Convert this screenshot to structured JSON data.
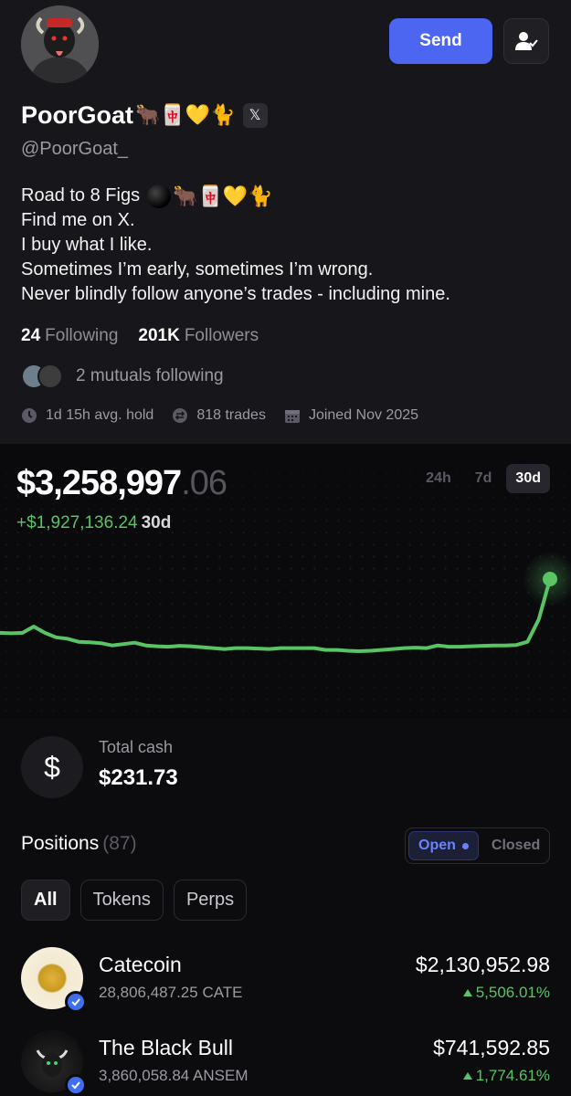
{
  "header": {
    "send_label": "Send"
  },
  "profile": {
    "name": "PoorGoat",
    "name_emojis": "🐂🀄💛🐈",
    "x_badge": "𝕏",
    "handle": "@PoorGoat_",
    "bio": [
      "Road to 8 Figs",
      "Find me on X.",
      "I buy what I like.",
      "Sometimes I’m early, sometimes I’m wrong.",
      "Never blindly follow anyone’s trades - including mine."
    ],
    "bio_emojis": "🐂🀄💛🐈",
    "following_count": "24",
    "following_label": "Following",
    "followers_count": "201K",
    "followers_label": "Followers",
    "mutuals_text": "2 mutuals following",
    "avg_hold": "1d 15h avg. hold",
    "trades": "818 trades",
    "joined": "Joined Nov 2025"
  },
  "portfolio": {
    "balance_main": "$3,258,997",
    "balance_cents": ".06",
    "change_value": "+$1,927,136.24",
    "change_period": "30d",
    "ranges": [
      "24h",
      "7d",
      "30d"
    ],
    "active_range": "30d",
    "accent_color": "#58c463"
  },
  "chart_data": {
    "type": "line",
    "title": "",
    "xlabel": "",
    "ylabel": "",
    "grid": false,
    "legend": "none",
    "x": [
      0,
      1,
      2,
      3,
      4,
      5,
      6,
      7,
      8,
      9,
      10,
      11,
      12,
      13,
      14,
      15,
      16,
      17,
      18,
      19,
      20,
      21,
      22,
      23,
      24,
      25,
      26,
      27,
      28,
      29,
      30,
      31,
      32,
      33,
      34,
      35,
      36,
      37,
      38,
      39,
      40,
      41,
      42,
      43,
      44,
      45,
      46,
      47,
      48,
      49
    ],
    "series": [
      {
        "values": [
          1.0,
          0.99,
          1.0,
          1.14,
          1.0,
          0.9,
          0.87,
          0.8,
          0.79,
          0.77,
          0.72,
          0.75,
          0.78,
          0.72,
          0.7,
          0.69,
          0.71,
          0.7,
          0.68,
          0.66,
          0.64,
          0.66,
          0.66,
          0.65,
          0.64,
          0.66,
          0.66,
          0.66,
          0.66,
          0.62,
          0.62,
          0.6,
          0.59,
          0.6,
          0.62,
          0.64,
          0.66,
          0.67,
          0.66,
          0.72,
          0.69,
          0.69,
          0.7,
          0.71,
          0.72,
          0.72,
          0.73,
          0.8,
          1.3,
          2.2
        ]
      }
    ]
  },
  "cash": {
    "icon_symbol": "$",
    "label": "Total cash",
    "value": "$231.73"
  },
  "positions": {
    "title": "Positions",
    "count": "(87)",
    "toggle_open": "Open",
    "toggle_closed": "Closed",
    "filters": [
      "All",
      "Tokens",
      "Perps"
    ],
    "items": [
      {
        "name": "Catecoin",
        "quantity": "28,806,487.25 CATE",
        "value": "$2,130,952.98",
        "change": "5,506.01%"
      },
      {
        "name": "The Black Bull",
        "quantity": "3,860,058.84 ANSEM",
        "value": "$741,592.85",
        "change": "1,774.61%"
      }
    ]
  }
}
